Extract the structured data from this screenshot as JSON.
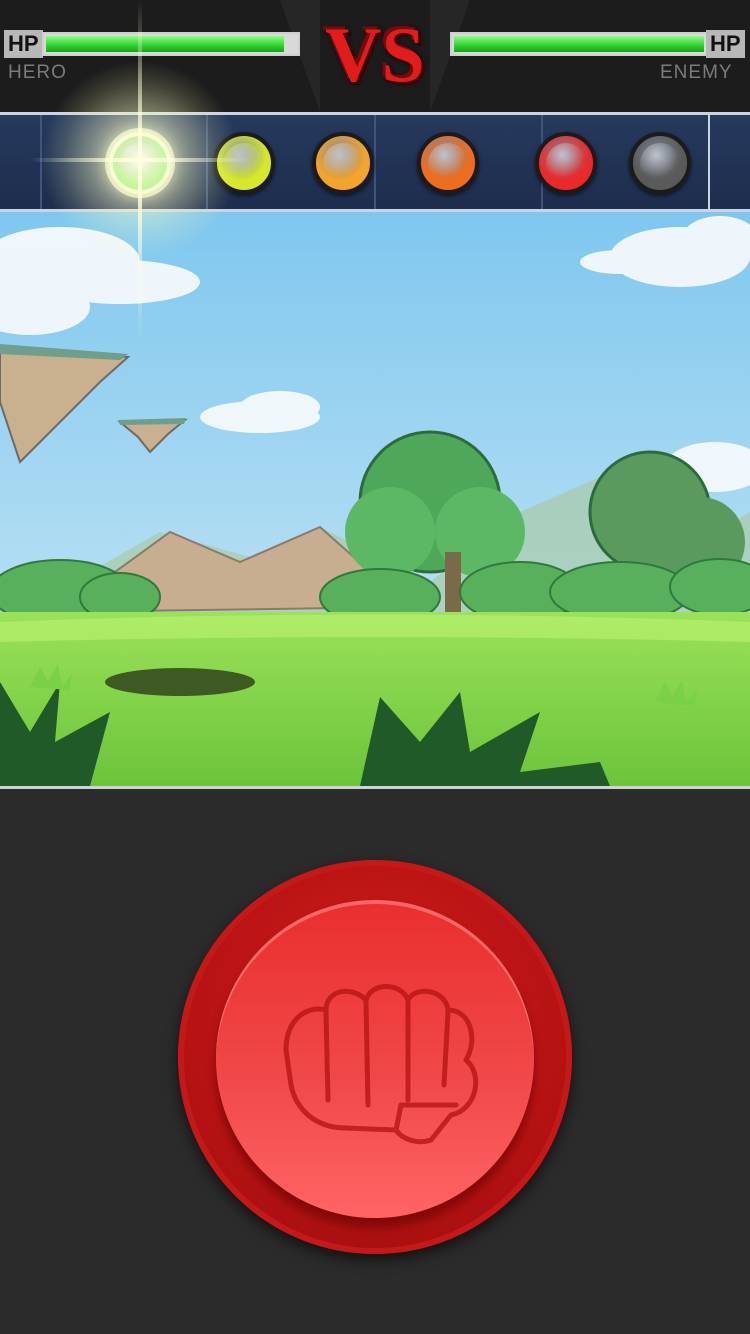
{
  "hud": {
    "hero": {
      "hp_label": "HP",
      "name": "HERO",
      "hp_fraction": 0.95
    },
    "enemy": {
      "hp_label": "HP",
      "name": "ENEMY",
      "hp_fraction": 1.0
    },
    "vs_label": "VS"
  },
  "timing_track": {
    "active_index": 0,
    "dots": [
      {
        "state": "active",
        "color": "#5fe23c",
        "icon": "green-note-icon"
      },
      {
        "state": "idle",
        "color": "#d6e82a",
        "icon": "yellow-note-icon"
      },
      {
        "state": "idle",
        "color": "#f3a42b",
        "icon": "orange-note-icon"
      },
      {
        "state": "idle",
        "color": "#ee6d1e",
        "icon": "dark-orange-note-icon"
      },
      {
        "state": "idle",
        "color": "#ea2a2a",
        "icon": "red-note-icon"
      },
      {
        "state": "empty",
        "color": "#5a5a5a",
        "icon": "gray-note-icon"
      }
    ]
  },
  "scene": {
    "description_icon": "meadow-battlefield"
  },
  "controls": {
    "punch_button_icon": "fist-icon",
    "colors": {
      "button": "#e52a2a",
      "ring": "#c01616"
    }
  }
}
